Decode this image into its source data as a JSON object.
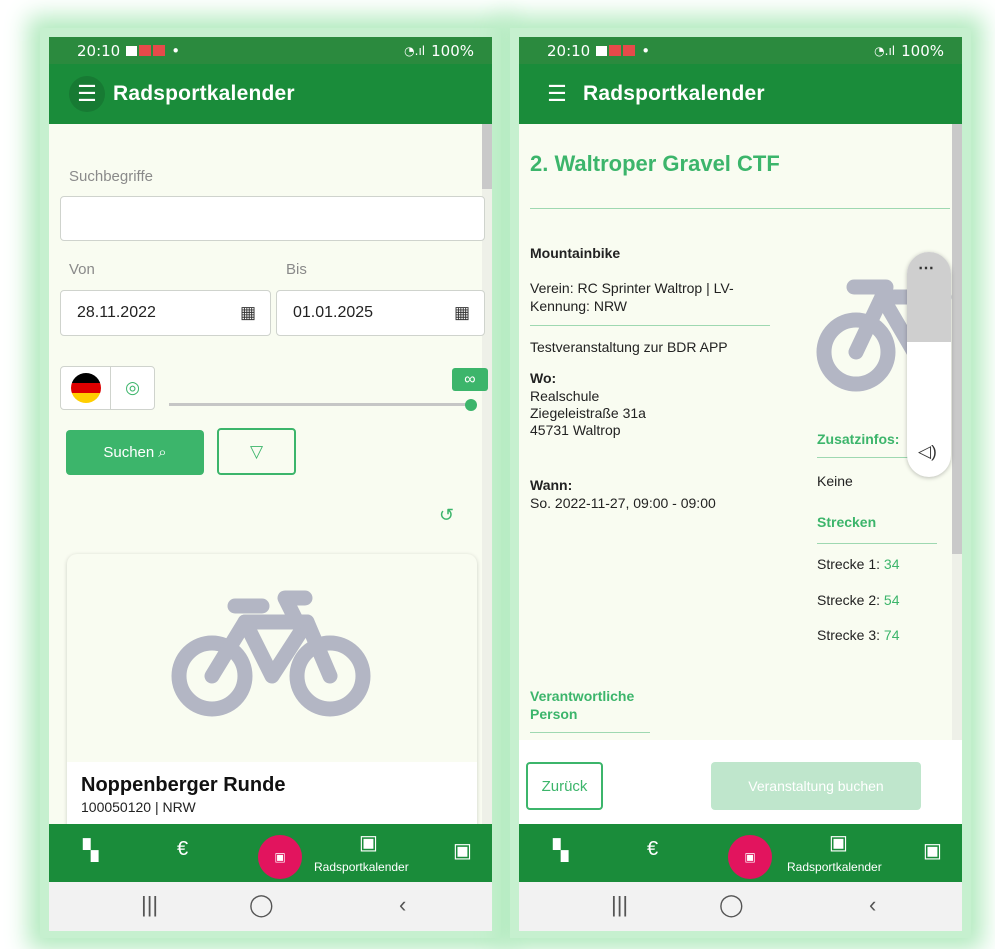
{
  "status_bar": {
    "time": "20:10",
    "battery": "100%"
  },
  "app_bar": {
    "title": "Radsportkalender"
  },
  "search_screen": {
    "search_label": "Suchbegriffe",
    "search_value": "",
    "from_label": "Von",
    "to_label": "Bis",
    "from_date": "28.11.2022",
    "to_date": "01.01.2025",
    "range_badge": "∞",
    "search_button": "Suchen",
    "card": {
      "title": "Noppenberger Runde",
      "subtitle": "100050120 | NRW"
    }
  },
  "detail_screen": {
    "title": "2. Waltroper Gravel CTF",
    "category": "Mountainbike",
    "club": "Verein: RC Sprinter Waltrop | LV-Kennung: NRW",
    "description": "Testveranstaltung zur BDR APP",
    "where_label": "Wo:",
    "address_lines": [
      "Realschule",
      "Ziegeleistraße 31a",
      "45731 Waltrop"
    ],
    "when_label": "Wann:",
    "when_value": "So. 2022-11-27, 09:00 - 09:00",
    "extra_label": "Zusatzinfos:",
    "extra_value": "Keine",
    "routes_label": "Strecken",
    "routes": [
      {
        "label": "Strecke 1:",
        "value": "34"
      },
      {
        "label": "Strecke 2:",
        "value": "54"
      },
      {
        "label": "Strecke 3:",
        "value": "74"
      }
    ],
    "responsible_label": "Verantwortliche Person",
    "back_button": "Zurück",
    "book_button": "Veranstaltung buchen"
  },
  "bottom_nav": {
    "active_label": "Radsportkalender"
  },
  "colors": {
    "appbar": "#1a8c3a",
    "accent": "#3cb56b",
    "fab": "#e2145e",
    "background": "#f9fcf1"
  }
}
